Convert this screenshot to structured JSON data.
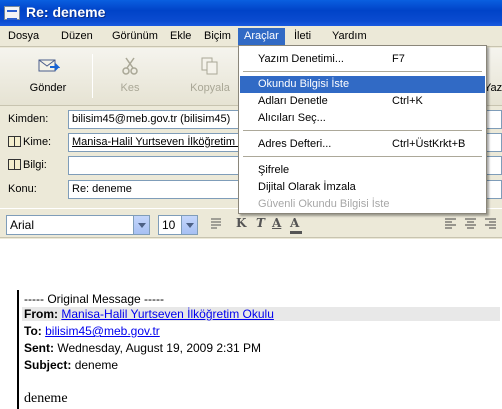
{
  "window": {
    "title": "Re: deneme"
  },
  "menu": {
    "items": [
      {
        "label": "Dosya"
      },
      {
        "label": "Düzen"
      },
      {
        "label": "Görünüm"
      },
      {
        "label": "Ekle"
      },
      {
        "label": "Biçim"
      },
      {
        "label": "Araçlar"
      },
      {
        "label": "İleti"
      },
      {
        "label": "Yardım"
      }
    ]
  },
  "toolbar": {
    "send_label": "Gönder",
    "cut_label": "Kes",
    "copy_label": "Kopyala",
    "partial_label": "Yaz"
  },
  "header": {
    "from_label": "Kimden:",
    "from_value": "bilisim45@meb.gov.tr   (bilisim45)",
    "to_label": "Kime:",
    "to_value": "Manisa-Halil Yurtseven İlköğretim O",
    "cc_label": "Bilgi:",
    "cc_value": "",
    "subject_label": "Konu:",
    "subject_value": "Re: deneme"
  },
  "format": {
    "font": "Arial",
    "size": "10",
    "bold": "K",
    "italic": "T",
    "underline": "A",
    "color": "A"
  },
  "tools_menu": {
    "items": [
      {
        "label": "Yazım Denetimi...",
        "shortcut": "F7",
        "state": "normal"
      },
      {
        "label": "Okundu Bilgisi İste",
        "shortcut": "",
        "state": "highlighted"
      },
      {
        "label": "Adları Denetle",
        "shortcut": "Ctrl+K",
        "state": "normal"
      },
      {
        "label": "Alıcıları Seç...",
        "shortcut": "",
        "state": "normal"
      },
      {
        "label": "Adres Defteri...",
        "shortcut": "Ctrl+ÜstKrkt+B",
        "state": "normal"
      },
      {
        "label": "Şifrele",
        "shortcut": "",
        "state": "normal"
      },
      {
        "label": "Dijital Olarak İmzala",
        "shortcut": "",
        "state": "normal"
      },
      {
        "label": "Güvenli Okundu Bilgisi İste",
        "shortcut": "",
        "state": "disabled"
      }
    ]
  },
  "message": {
    "original_header": "----- Original Message -----",
    "from_label": "From:",
    "from_value": "Manisa-Halil Yurtseven İlköğretim Okulu",
    "to_label": "To:",
    "to_value": "bilisim45@meb.gov.tr",
    "sent_label": "Sent:",
    "sent_value": "Wednesday, August 19, 2009 2:31 PM",
    "subject_label": "Subject:",
    "subject_value": "deneme",
    "body": "deneme"
  },
  "colors": {
    "titlebar": "#0043c8",
    "menu_highlight": "#316ac5",
    "link": "#0000ee"
  }
}
